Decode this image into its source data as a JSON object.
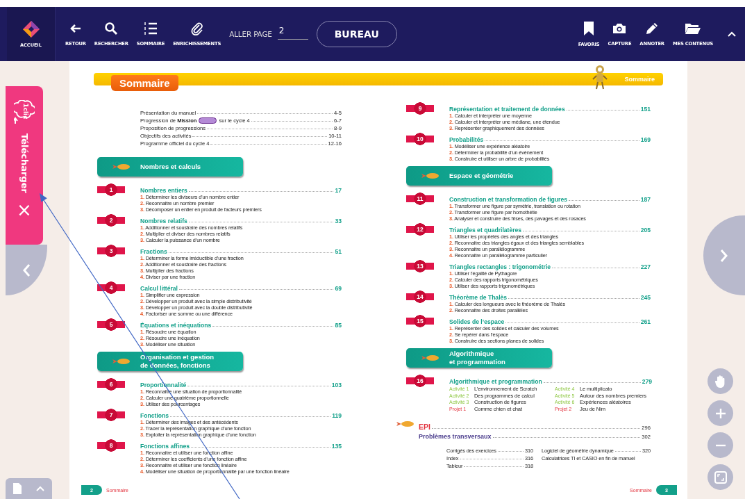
{
  "toolbar": {
    "home": {
      "label": "ACCUEIL"
    },
    "left_tools": [
      {
        "label": "RETOUR"
      },
      {
        "label": "RECHERCHER"
      },
      {
        "label": "SOMMAIRE"
      },
      {
        "label": "ENRICHISSEMENTS"
      }
    ],
    "goto_page": {
      "label": "ALLER PAGE",
      "value": "2"
    },
    "desk_button": "BUREAU",
    "right_tools": [
      {
        "label": "FAVORIS"
      },
      {
        "label": "CAPTURE"
      },
      {
        "label": "ANNOTER"
      },
      {
        "label": "MES CONTENUS"
      }
    ]
  },
  "download_tab": {
    "badge": "1clic",
    "label": "Télécharger",
    "close": "×"
  },
  "page": {
    "header_tab": "Sommaire",
    "header_right": "Sommaire",
    "left_column": {
      "intro": [
        {
          "label": "Présentation du manuel",
          "pages": "4-5"
        },
        {
          "label": "Progression de **Mission**",
          "label_after": "sur le cycle 4",
          "pages": "6-7"
        },
        {
          "label": "Proposition de progressions",
          "pages": "8-9"
        },
        {
          "label": "Objectifs des activités",
          "pages": "10-11"
        },
        {
          "label": "Programme officiel du cycle 4",
          "pages": "12-16"
        }
      ],
      "blocks": [
        {
          "kind": "section",
          "lines": [
            "Nombres et calculs"
          ]
        },
        {
          "kind": "chapter",
          "number": "1",
          "title": "Nombres entiers",
          "page": "17",
          "items": [
            {
              "n": "1.",
              "text": "Déterminer les diviseurs d’un nombre entier"
            },
            {
              "n": "2.",
              "text": "Reconnaitre un nombre premier"
            },
            {
              "n": "3.",
              "text": "Décomposer un entier en produit de facteurs premiers"
            }
          ]
        },
        {
          "kind": "chapter",
          "number": "2",
          "title": "Nombres relatifs",
          "page": "33",
          "items": [
            {
              "n": "1.",
              "text": "Additionner et soustraire des nombres relatifs"
            },
            {
              "n": "2.",
              "text": "Multiplier et diviser des nombres relatifs"
            },
            {
              "n": "3.",
              "text": "Calculer la puissance d’un nombre"
            }
          ]
        },
        {
          "kind": "chapter",
          "number": "3",
          "title": "Fractions",
          "page": "51",
          "items": [
            {
              "n": "1.",
              "text": "Déterminer la forme irréductible d’une fraction"
            },
            {
              "n": "2.",
              "text": "Additionner et soustraire des fractions"
            },
            {
              "n": "3.",
              "text": "Multiplier des fractions"
            },
            {
              "n": "4.",
              "text": "Diviser par une fraction"
            }
          ]
        },
        {
          "kind": "chapter",
          "number": "4",
          "title": "Calcul littéral",
          "page": "69",
          "items": [
            {
              "n": "1.",
              "text": "Simplifier une expression"
            },
            {
              "n": "2.",
              "text": "Développer un produit avec la simple distributivité"
            },
            {
              "n": "3.",
              "text": "Développer un produit avec la double distributivité"
            },
            {
              "n": "4.",
              "text": "Factoriser une somme ou une différence"
            }
          ]
        },
        {
          "kind": "chapter",
          "number": "5",
          "title": "Équations et inéquations",
          "page": "85",
          "items": [
            {
              "n": "1.",
              "text": "Résoudre une équation"
            },
            {
              "n": "2.",
              "text": "Résoudre une inéquation"
            },
            {
              "n": "3.",
              "text": "Modéliser une situation"
            }
          ]
        },
        {
          "kind": "section",
          "lines": [
            "Organisation et gestion",
            "de données, fonctions"
          ]
        },
        {
          "kind": "chapter",
          "number": "6",
          "title": "Proportionnalité",
          "page": "103",
          "items": [
            {
              "n": "1.",
              "text": "Reconnaitre une situation de proportionnalité"
            },
            {
              "n": "2.",
              "text": "Calculer une quatrième proportionnelle"
            },
            {
              "n": "3.",
              "text": "Utiliser des pourcentages"
            }
          ]
        },
        {
          "kind": "chapter",
          "number": "7",
          "title": "Fonctions",
          "page": "119",
          "items": [
            {
              "n": "1.",
              "text": "Déterminer des images et des antécédents"
            },
            {
              "n": "2.",
              "text": "Tracer la représentation graphique d’une fonction"
            },
            {
              "n": "3.",
              "text": "Exploiter la représentation graphique d’une fonction"
            }
          ]
        },
        {
          "kind": "chapter",
          "number": "8",
          "title": "Fonctions affines",
          "page": "135",
          "items": [
            {
              "n": "1.",
              "text": "Reconnaitre et utiliser une fonction affine"
            },
            {
              "n": "2.",
              "text": "Déterminer les coefficients d’une fonction affine"
            },
            {
              "n": "3.",
              "text": "Reconnaitre et utiliser une fonction linéaire"
            },
            {
              "n": "4.",
              "text": "Modéliser une situation de proportionnalité par une fonction linéaire"
            }
          ]
        }
      ]
    },
    "right_column": {
      "blocks": [
        {
          "kind": "chapter",
          "number": "9",
          "title": "Représentation et traitement de données",
          "page": "151",
          "items": [
            {
              "n": "1.",
              "text": "Calculer et interpréter une moyenne"
            },
            {
              "n": "2.",
              "text": "Calculer et interpréter une médiane, une étendue"
            },
            {
              "n": "3.",
              "text": "Représenter graphiquement des données"
            }
          ]
        },
        {
          "kind": "chapter",
          "number": "10",
          "title": "Probabilités",
          "page": "169",
          "items": [
            {
              "n": "1.",
              "text": "Modéliser une expérience aléatoire"
            },
            {
              "n": "2.",
              "text": "Déterminer la probabilité d’un évènement"
            },
            {
              "n": "3.",
              "text": "Construire et utiliser un arbre de probabilités"
            }
          ]
        },
        {
          "kind": "section",
          "lines": [
            "Espace et géométrie"
          ]
        },
        {
          "kind": "chapter",
          "number": "11",
          "title": "Construction et transformation de figures",
          "page": "187",
          "items": [
            {
              "n": "1.",
              "text": "Transformer une figure par symétrie, translation ou rotation"
            },
            {
              "n": "2.",
              "text": "Transformer une figure par homothétie"
            },
            {
              "n": "3.",
              "text": "Analyser et construire des frises, des pavages et des rosaces"
            }
          ]
        },
        {
          "kind": "chapter",
          "number": "12",
          "title": "Triangles et quadrilatères",
          "page": "205",
          "items": [
            {
              "n": "1.",
              "text": "Utiliser les propriétés des angles et des triangles"
            },
            {
              "n": "2.",
              "text": "Reconnaitre des triangles égaux et des triangles semblables"
            },
            {
              "n": "3.",
              "text": "Reconnaitre un parallélogramme"
            },
            {
              "n": "4.",
              "text": "Reconnaitre un parallélogramme particulier"
            }
          ]
        },
        {
          "kind": "chapter",
          "number": "13",
          "title": "Triangles rectangles : trigonométrie",
          "page": "227",
          "items": [
            {
              "n": "1.",
              "text": "Utiliser l’égalité de Pythagore"
            },
            {
              "n": "2.",
              "text": "Calculer des rapports trigonométriques"
            },
            {
              "n": "3.",
              "text": "Utiliser des rapports trigonométriques"
            }
          ]
        },
        {
          "kind": "chapter",
          "number": "14",
          "title": "Théorème de Thalès",
          "page": "245",
          "items": [
            {
              "n": "1.",
              "text": "Calculer des longueurs avec le théorème de Thalès"
            },
            {
              "n": "2.",
              "text": "Reconnaitre des droites parallèles"
            }
          ]
        },
        {
          "kind": "chapter",
          "number": "15",
          "title": "Solides de l’espace",
          "page": "261",
          "items": [
            {
              "n": "1.",
              "text": "Représenter des solides et calculer des volumes"
            },
            {
              "n": "2.",
              "text": "Se repérer dans l’espace"
            },
            {
              "n": "3.",
              "text": "Construire des sections planes de solides"
            }
          ]
        },
        {
          "kind": "section",
          "lines": [
            "Algorithmique",
            "et programmation"
          ]
        },
        {
          "kind": "chapter",
          "number": "16",
          "title": "Algorithmique et programmation",
          "page": "279",
          "activity_columns": [
            [
              {
                "kind": "activity",
                "label": "Activité 1",
                "text": "L’environnement de Scratch"
              },
              {
                "kind": "activity",
                "label": "Activité 2",
                "text": "Des programmes de calcul"
              },
              {
                "kind": "activity",
                "label": "Activité 3",
                "text": "Construction de figures"
              },
              {
                "kind": "project",
                "label": "Projet 1",
                "text": "Comme chien et chat"
              }
            ],
            [
              {
                "kind": "activity",
                "label": "Activité 4",
                "text": "Le multiplicato"
              },
              {
                "kind": "activity",
                "label": "Activité 5",
                "text": "Autour des nombres premiers"
              },
              {
                "kind": "activity",
                "label": "Activité 6",
                "text": "Expériences aléatoires"
              },
              {
                "kind": "project",
                "label": "Projet 2",
                "text": "Jeu de Nim"
              }
            ]
          ]
        }
      ],
      "extras": [
        {
          "kind": "epi",
          "title": "EPI",
          "page": "296"
        },
        {
          "kind": "transversal",
          "title": "Problèmes transversaux",
          "page": "302"
        }
      ],
      "annex_columns": [
        [
          {
            "label": "Corrigés des exercices",
            "page": "310"
          },
          {
            "label": "Index",
            "page": "316"
          },
          {
            "label": "Tableur",
            "page": "318"
          }
        ],
        [
          {
            "label": "Logiciel de géométrie dynamique",
            "page": "320"
          },
          {
            "label": "Calculatrices TI et CASIO en fin de manuel"
          }
        ]
      ]
    },
    "footer_left": {
      "number": "2",
      "label": "Sommaire"
    },
    "footer_right": {
      "label": "Sommaire",
      "number": "3"
    }
  }
}
